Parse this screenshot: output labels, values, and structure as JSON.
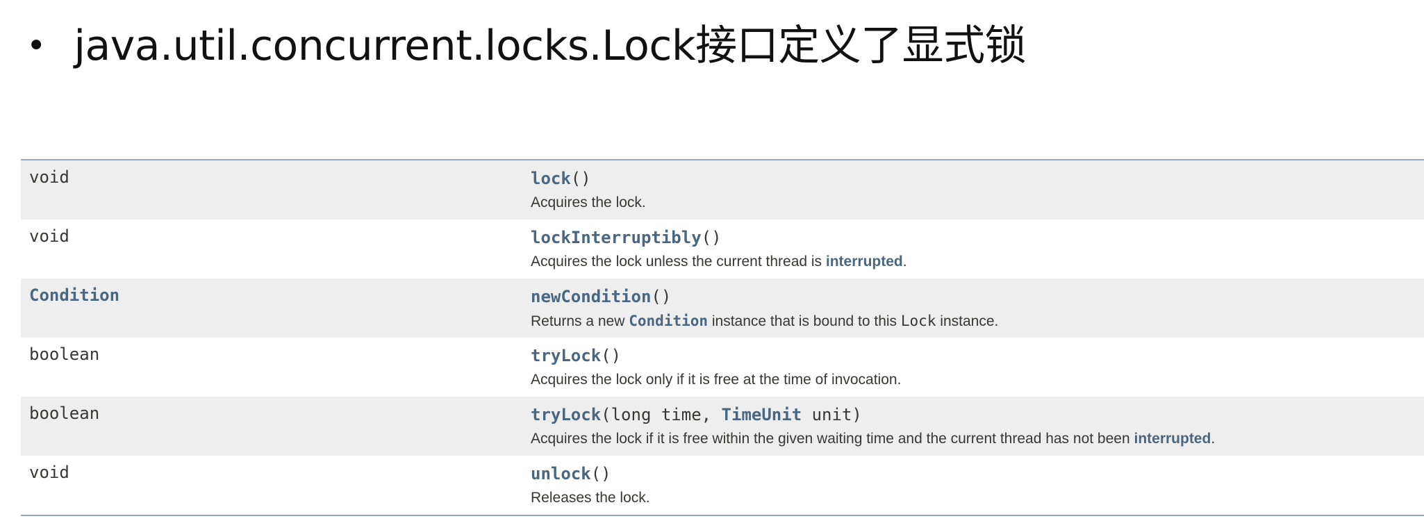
{
  "heading": {
    "bullet": "•",
    "text": "java.util.concurrent.locks.Lock接口定义了显式锁"
  },
  "methods": [
    {
      "type": "void",
      "name": "lock",
      "args_open": "(",
      "args_close": ")",
      "desc": "Acquires the lock."
    },
    {
      "type": "void",
      "name": "lockInterruptibly",
      "args_open": "(",
      "args_close": ")",
      "desc_before": "Acquires the lock unless the current thread is ",
      "desc_link": "interrupted",
      "desc_after": "."
    },
    {
      "type": "Condition",
      "name": "newCondition",
      "args_open": "(",
      "args_close": ")",
      "desc_before": "Returns a new ",
      "desc_code_link": "Condition",
      "desc_mid": " instance that is bound to this ",
      "desc_code": "Lock",
      "desc_after": " instance."
    },
    {
      "type": "boolean",
      "name": "tryLock",
      "args_open": "(",
      "args_close": ")",
      "desc": "Acquires the lock only if it is free at the time of invocation."
    },
    {
      "type": "boolean",
      "name": "tryLock",
      "args_open": "(long time, ",
      "param_type": "TimeUnit",
      "args_close": " unit)",
      "desc_before": "Acquires the lock if it is free within the given waiting time and the current thread has not been ",
      "desc_link": "interrupted",
      "desc_after": "."
    },
    {
      "type": "void",
      "name": "unlock",
      "args_open": "(",
      "args_close": ")",
      "desc": "Releases the lock."
    }
  ],
  "colors": {
    "link": "#4a6782",
    "text": "#353833",
    "row_alt": "#eeeeee",
    "border": "#9aa6b8"
  }
}
